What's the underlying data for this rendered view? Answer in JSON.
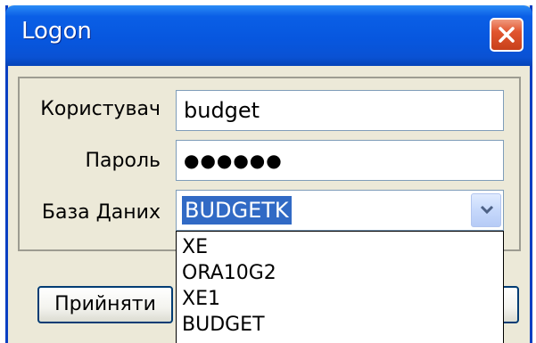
{
  "window": {
    "title": "Logon"
  },
  "form": {
    "user_label": "Користувач",
    "user_value": "budget",
    "password_label": "Пароль",
    "password_mask": "●●●●●●",
    "database_label": "База Даних",
    "database_selected": "BUDGETK"
  },
  "dropdown": {
    "options": [
      "XE",
      "ORA10G2",
      "XE1",
      "BUDGET"
    ]
  },
  "buttons": {
    "accept_label": "Прийняти"
  },
  "colors": {
    "titlebar": "#0757df",
    "close": "#e1552f",
    "selection": "#316ac5",
    "dialog_bg": "#ece9d8"
  },
  "icons": {
    "close": "close-icon",
    "dropdown": "chevron-down-icon"
  }
}
